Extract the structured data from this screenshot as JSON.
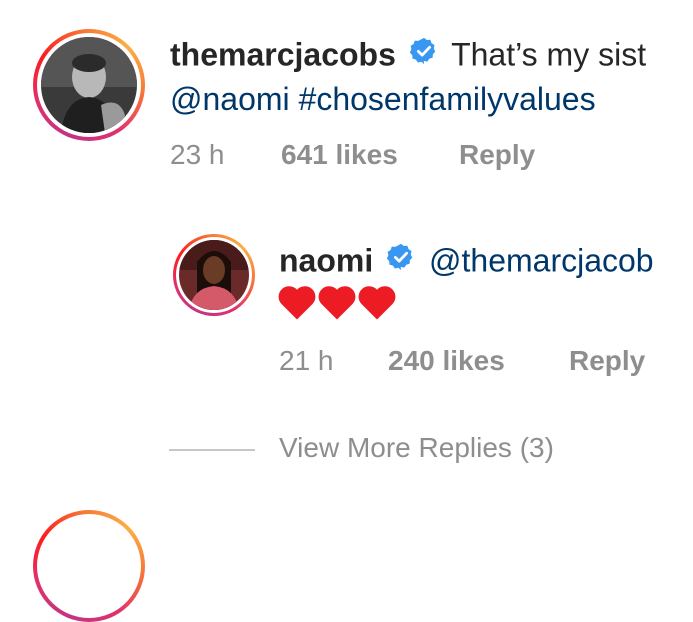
{
  "comment": {
    "username": "themarcjacobs",
    "text": "That’s my sist",
    "line2": "@naomi #chosenfamilyvalues",
    "time": "23 h",
    "likes": "641 likes",
    "reply": "Reply"
  },
  "reply_comment": {
    "username": "naomi",
    "mention": "@themarcjacob",
    "hearts": "❤❤❤",
    "time": "21 h",
    "likes": "240 likes",
    "reply": "Reply"
  },
  "view_more": "View More Replies (3)",
  "colors": {
    "text": "#262626",
    "link": "#00376b",
    "meta": "#8e8e8e",
    "verified": "#3897f0",
    "heart": "#ed1c24"
  }
}
